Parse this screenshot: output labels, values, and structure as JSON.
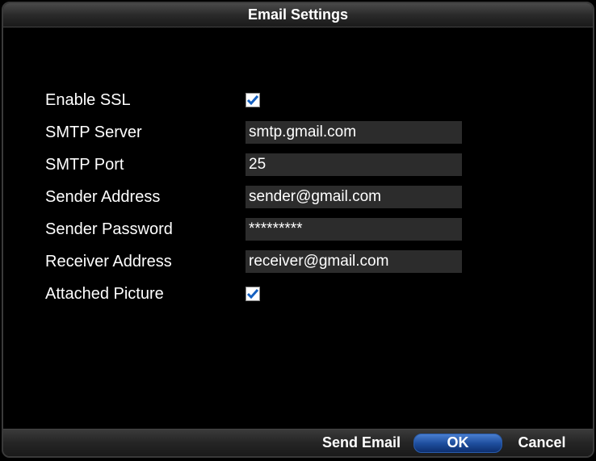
{
  "dialog": {
    "title": "Email Settings"
  },
  "form": {
    "enable_ssl_label": "Enable SSL",
    "enable_ssl_checked": true,
    "smtp_server_label": "SMTP Server",
    "smtp_server_value": "smtp.gmail.com",
    "smtp_port_label": "SMTP Port",
    "smtp_port_value": "25",
    "sender_address_label": "Sender Address",
    "sender_address_value": "sender@gmail.com",
    "sender_password_label": "Sender Password",
    "sender_password_value": "*********",
    "receiver_address_label": "Receiver Address",
    "receiver_address_value": "receiver@gmail.com",
    "attached_picture_label": "Attached Picture",
    "attached_picture_checked": true
  },
  "footer": {
    "send_email": "Send Email",
    "ok": "OK",
    "cancel": "Cancel"
  }
}
